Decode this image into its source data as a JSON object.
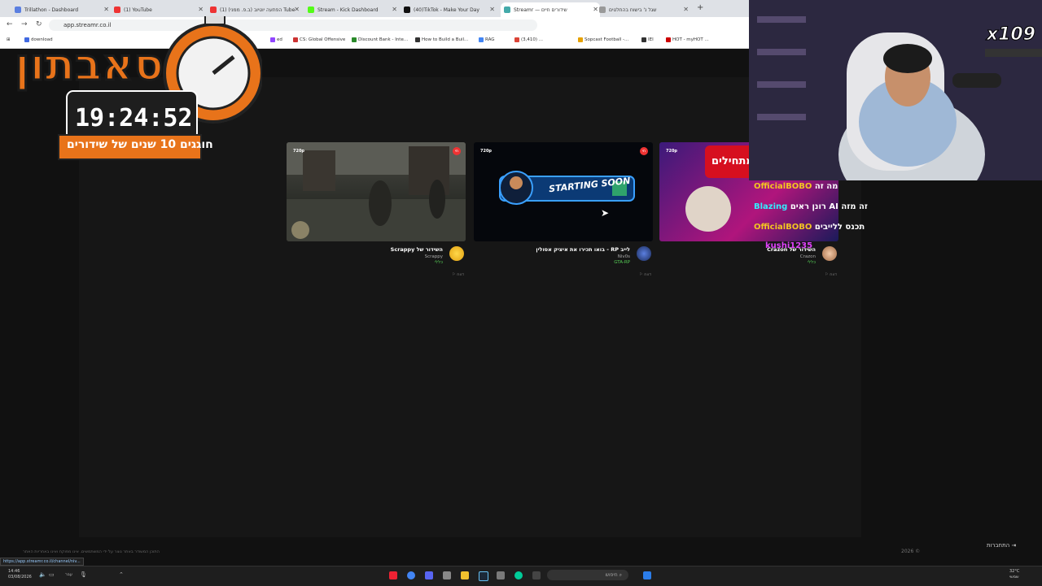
{
  "browser": {
    "tabs": [
      {
        "label": "Trillathon - Dashboard",
        "color": "#5b7fe0"
      },
      {
        "label": "(1) YouTube",
        "color": "#e33"
      },
      {
        "label": "(1) הפתעה יוטיוב (ב.פ. ממני) Tube",
        "color": "#e33"
      },
      {
        "label": "Stream - Kick Dashboard",
        "color": "#53fc18"
      },
      {
        "label": "(40)TikTok - Make Your Day",
        "color": "#111"
      },
      {
        "label": "Streamr — שידורים חיים",
        "color": "#4aa"
      },
      {
        "label": "שגל נ' בישוח בהחלטים",
        "color": "#999"
      }
    ],
    "address": "app.streamr.co.il",
    "bookmarks": [
      {
        "label": "download",
        "color": "#4169e1"
      },
      {
        "label": "ed",
        "color": "#9146ff"
      },
      {
        "label": "CS: Global Offensive",
        "color": "#c33"
      },
      {
        "label": "Discount Bank - Inte...",
        "color": "#2a8a2a"
      },
      {
        "label": "How to Build a Buil...",
        "color": "#333"
      },
      {
        "label": "RAG",
        "color": "#4285f4"
      },
      {
        "label": "(3,410) ...",
        "color": "#db4437"
      },
      {
        "label": "Sopcast Football -...",
        "color": "#e6a100"
      },
      {
        "label": "IEI",
        "color": "#333"
      },
      {
        "label": "HOT - myHOT ...",
        "color": "#c00"
      }
    ]
  },
  "overlay": {
    "logo_title": "סאבתון",
    "timer": "19:24:52",
    "tagline": "חוגגים 10 שנים של שידורים",
    "multiplier": "x109",
    "chat": [
      {
        "user": "OfficialBOBO",
        "msg": "מה זה",
        "color": "#f3c522"
      },
      {
        "user": "Blazing",
        "msg": "רונן ראים AI זה מזה",
        "color": "#3ef"
      },
      {
        "user": "OfficialBOBO",
        "msg": "תכנס ללייבים",
        "color": "#f3c522"
      },
      {
        "user": "kushi1235",
        "msg": "",
        "color": "#e040fb"
      }
    ]
  },
  "cards": [
    {
      "res": "720p",
      "title": "השידור של Scrappy",
      "name": "Scrappy",
      "category": "כללי",
      "report": "דווח",
      "live": "חי"
    },
    {
      "res": "720p",
      "title": "לייב RP - בואו תכירו את איציק אסולין",
      "name": "Niv0s",
      "category": "GTA-RP",
      "report": "דווח",
      "live": "חי",
      "thumb_text": "STARTING SOON"
    },
    {
      "res": "720p",
      "title": "השידור של Crazon",
      "name": "Crazon",
      "category": "כללי",
      "report": "דווח",
      "live": "חי",
      "thumb_text": "מתחילים"
    }
  ],
  "footer": {
    "left": "התוכן המשודר באתר נוצר על ידי המשתמשים. אינו מפוקח ואינו באחריות האתר",
    "right": "2026 ©",
    "login": "התחברות",
    "status_url": "https://app.streamr.co.il/channel/niv..."
  },
  "taskbar": {
    "time": "14:46",
    "date": "03/08/2026",
    "search": "חיפוש",
    "lang": "עבר",
    "temp": "32°C",
    "weather": "שמשי"
  },
  "colors": {
    "accent": "#e8731a",
    "live": "#e33",
    "category": "#55cc55"
  }
}
